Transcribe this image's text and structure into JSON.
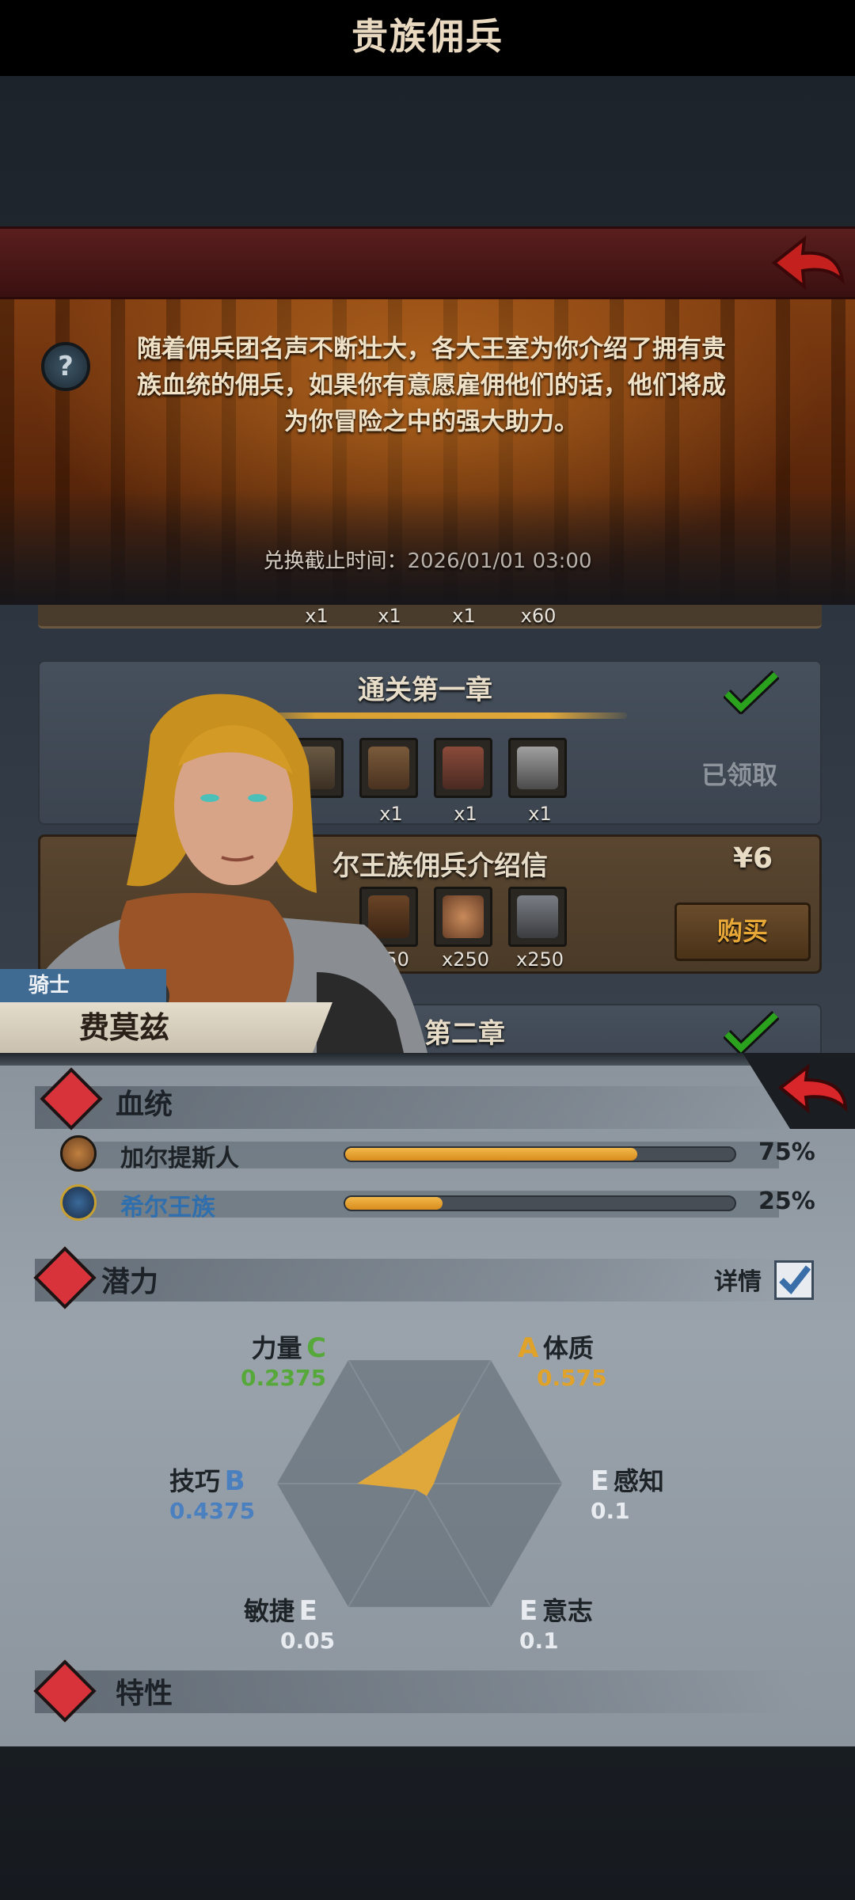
{
  "header": {
    "title": "贵族佣兵"
  },
  "banner": {
    "description": "随着佣兵团名声不断壮大，各大王室为你介绍了拥有贵族血统的佣兵，如果你有意愿雇佣他们的话，他们将成为你冒险之中的强大助力。",
    "deadline_label": "兑换截止时间：",
    "deadline_value": "2026/01/01 03:00"
  },
  "top_strip": {
    "quantities": [
      "x1",
      "x1",
      "x1",
      "x60"
    ]
  },
  "cards": [
    {
      "title": "通关第一章",
      "status": "已领取",
      "quantities": [
        "x1",
        "x1",
        "x1"
      ]
    },
    {
      "title": "尔王族佣兵介绍信",
      "price": "¥6",
      "button": "购买",
      "quantities": [
        "250",
        "x250",
        "x250"
      ]
    },
    {
      "title": "第二章"
    }
  ],
  "hero": {
    "class": "骑士",
    "name": "费莫兹"
  },
  "bloodline": {
    "title": "血统",
    "lines": [
      {
        "name": "加尔提斯人",
        "percent": "75%",
        "fill": 0.75,
        "label_color": "#1e2328"
      },
      {
        "name": "希尔王族",
        "percent": "25%",
        "fill": 0.25,
        "label_color": "#2f6fae"
      }
    ]
  },
  "potential": {
    "title": "潜力",
    "detail_label": "详情",
    "detail_checked": true,
    "stats": [
      {
        "name": "力量",
        "grade": "C",
        "value": "0.2375",
        "color": "#57a83a"
      },
      {
        "name": "体质",
        "grade": "A",
        "value": "0.575",
        "color": "#e0a228"
      },
      {
        "name": "感知",
        "grade": "E",
        "value": "0.1",
        "color": "#e8ecf0"
      },
      {
        "name": "意志",
        "grade": "E",
        "value": "0.1",
        "color": "#e8ecf0"
      },
      {
        "name": "敏捷",
        "grade": "E",
        "value": "0.05",
        "color": "#e8ecf0"
      },
      {
        "name": "技巧",
        "grade": "B",
        "value": "0.4375",
        "color": "#4a7fc0"
      }
    ]
  },
  "traits": {
    "title": "特性"
  },
  "colors": {
    "accent_gold": "#e0a83a",
    "title_red": "#4a1616",
    "check_green": "#2aa21e"
  },
  "icons": [
    "help-icon",
    "back-arrow-icon",
    "check-icon",
    "bloodline-icon",
    "potential-icon",
    "traits-icon"
  ]
}
